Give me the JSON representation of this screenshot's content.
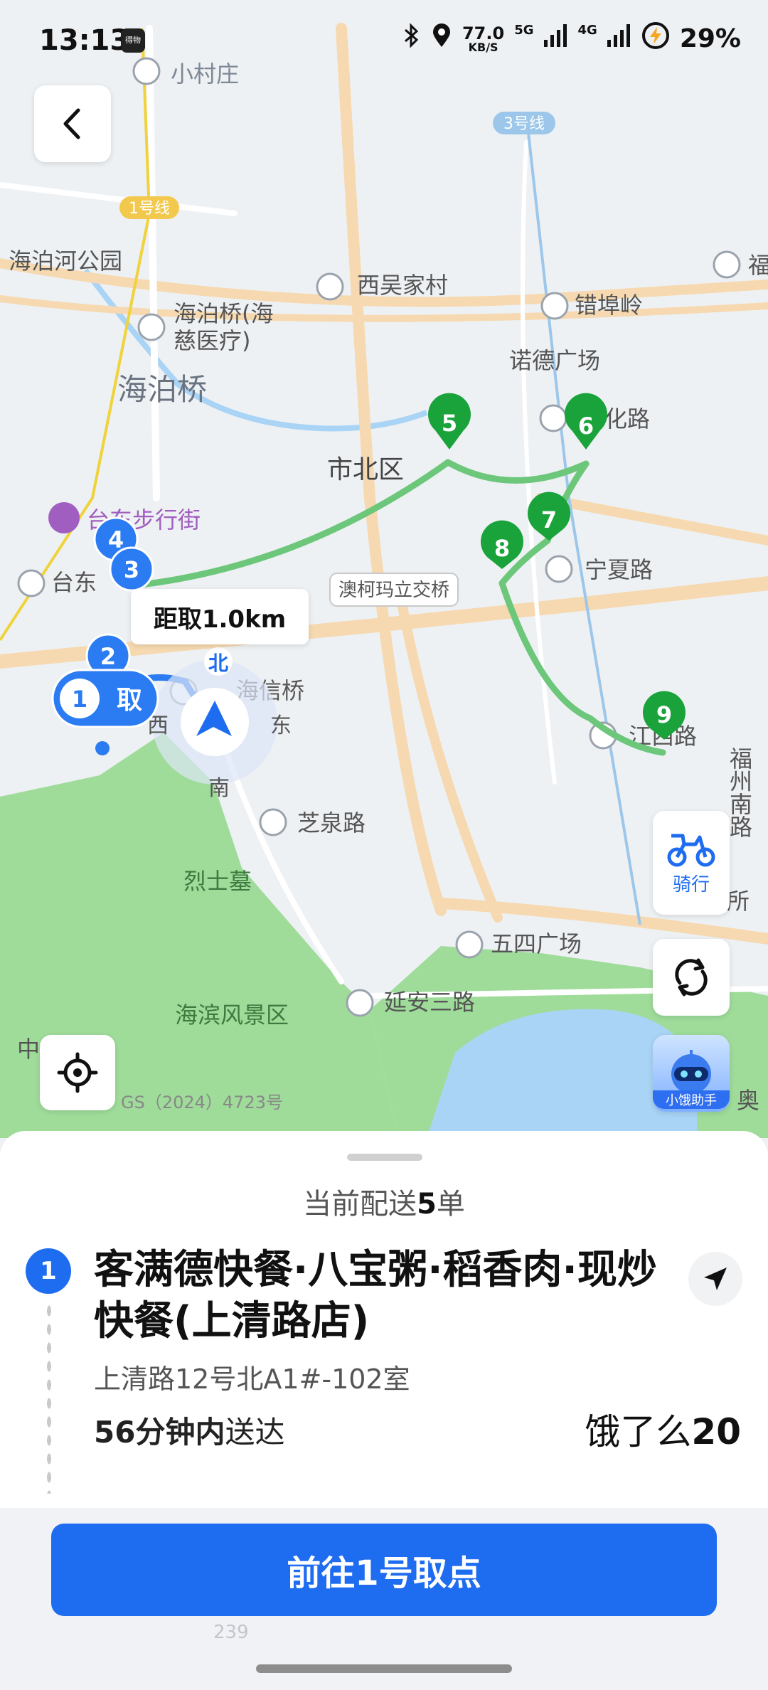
{
  "status_bar": {
    "time": "13:13",
    "app_badge": "得物",
    "net_speed_value": "77.0",
    "net_speed_unit": "KB/S",
    "sim1": "5G",
    "sim2": "4G",
    "battery": "29%"
  },
  "map": {
    "labels": {
      "xiaocunzhuang": "小村庄",
      "line1": "1号线",
      "line3": "3号线",
      "haipohe_park": "海泊河公园",
      "xiwu": "西吴家村",
      "haipoqiao_station": "海泊桥(海",
      "haipoqiao_station2": "慈医疗)",
      "cuobuling": "错埠岭",
      "nuode": "诺德广场",
      "haipoqiao": "海泊桥",
      "shibei": "市北区",
      "hualu": "化路",
      "taidong_street": "台东步行街",
      "taidong": "台东",
      "aokemali": "澳柯玛立交桥",
      "ningxia": "宁夏路",
      "haixin": "海信桥",
      "jiangxi": "江西路",
      "zhiquan": "芝泉路",
      "lieshimu": "烈士墓",
      "wusi": "五四广场",
      "haibin": "海滨风景区",
      "yanan": "延安三路",
      "zhong": "中",
      "fu": "福",
      "ao": "奥",
      "fuzhou": "福州南路",
      "suo": "所",
      "compass_n": "北",
      "compass_s": "南",
      "compass_e": "东",
      "compass_w": "西"
    },
    "markers": {
      "m1": "1",
      "m1_tag": "取",
      "m2": "2",
      "m3": "3",
      "m4": "4",
      "m5": "5",
      "m6": "6",
      "m7": "7",
      "m8": "8",
      "m9": "9"
    },
    "distance_label": "距取1.0km",
    "copyright": "GS（2024）4723号",
    "ride_label": "骑行",
    "assistant_label": "小饿助手"
  },
  "order": {
    "current_prefix": "当前配送",
    "current_count": "5",
    "current_suffix": "单",
    "index": "1",
    "store_name": "客满德快餐·八宝粥·稻香肉·现炒快餐(上清路店)",
    "address": "上清路12号北A1#-102室",
    "eta_bold": "56分钟内",
    "eta_suffix": "送达",
    "platform_name": "饿了么",
    "platform_num": "20"
  },
  "footer": {
    "go_button": "前往1号取点",
    "ghost_text": "239"
  },
  "colors": {
    "primary": "#1e6cf0",
    "green_marker": "#1aa33a",
    "route_green": "#6cc77a",
    "park_green": "#9fdc9a",
    "water": "#a9d4f5",
    "road": "#f6d9b0"
  }
}
